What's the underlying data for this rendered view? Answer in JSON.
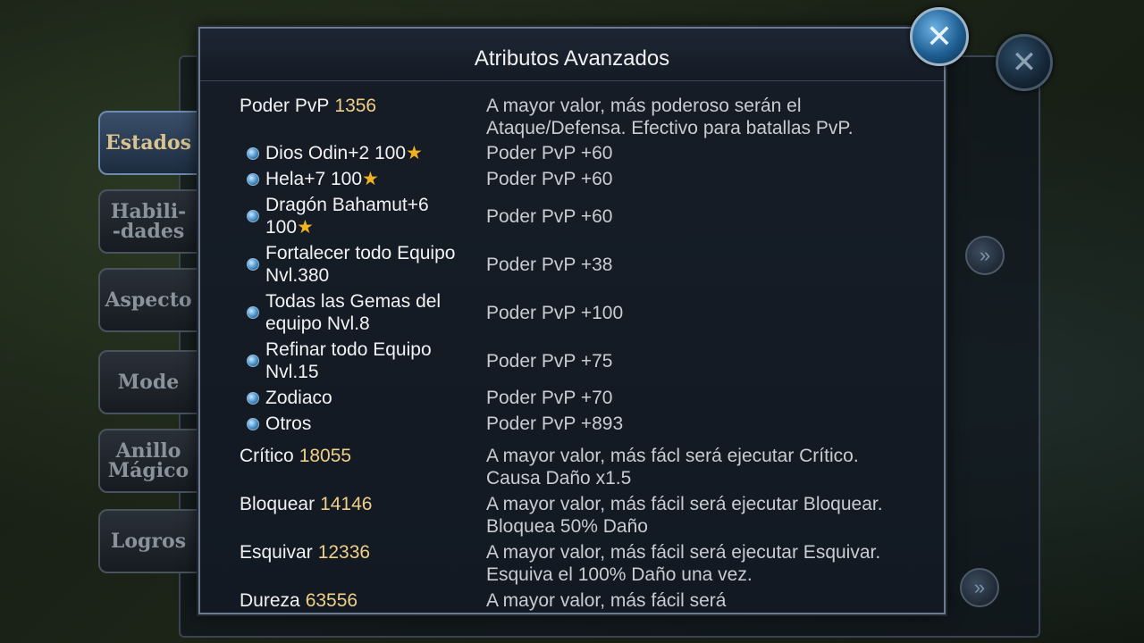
{
  "background": {
    "tabs": [
      {
        "label": "Estados",
        "active": true
      },
      {
        "label": "Habili-\n-dades",
        "active": false
      },
      {
        "label": "Aspecto",
        "active": false
      },
      {
        "label": "Mode",
        "active": false
      },
      {
        "label": "Anillo\nMágico",
        "active": false
      },
      {
        "label": "Logros",
        "active": false
      }
    ],
    "close_icon": "close-x-icon",
    "arrow_icon": "double-chevron-right-icon"
  },
  "dialog": {
    "title": "Atributos Avanzados",
    "close_icon": "close-x-icon",
    "pvp": {
      "label": "Poder PvP",
      "value": "1356",
      "desc": "A mayor valor, más poderoso serán el Ataque/Defensa. Efectivo para batallas PvP.",
      "items": [
        {
          "label": "Dios Odin+2 100",
          "star": "★",
          "desc": "Poder PvP +60"
        },
        {
          "label": "Hela+7 100",
          "star": "★",
          "desc": "Poder PvP +60"
        },
        {
          "label": "Dragón Bahamut+6 100",
          "star": "★",
          "desc": "Poder PvP +60"
        },
        {
          "label": "Fortalecer todo Equipo Nvl.380",
          "star": "",
          "desc": "Poder PvP +38"
        },
        {
          "label": "Todas las Gemas del equipo Nvl.8",
          "star": "",
          "desc": "Poder PvP +100"
        },
        {
          "label": "Refinar todo Equipo Nvl.15",
          "star": "",
          "desc": "Poder PvP +75"
        },
        {
          "label": "Zodiaco",
          "star": "",
          "desc": "Poder PvP +70"
        },
        {
          "label": "Otros",
          "star": "",
          "desc": "Poder PvP +893"
        }
      ]
    },
    "stats": [
      {
        "label": "Crítico",
        "value": "18055",
        "desc": "A mayor valor, más fácl será ejecutar Crítico. Causa Daño x1.5"
      },
      {
        "label": "Bloquear",
        "value": "14146",
        "desc": "A mayor valor, más fácil será ejecutar Bloquear. Bloquea 50% Daño"
      },
      {
        "label": "Esquivar",
        "value": "12336",
        "desc": "A mayor valor, más fácil será ejecutar Esquivar. Esquiva el 100% Daño una vez."
      },
      {
        "label": "Dureza",
        "value": "63556",
        "desc": "A mayor valor, más fácil será"
      }
    ]
  }
}
